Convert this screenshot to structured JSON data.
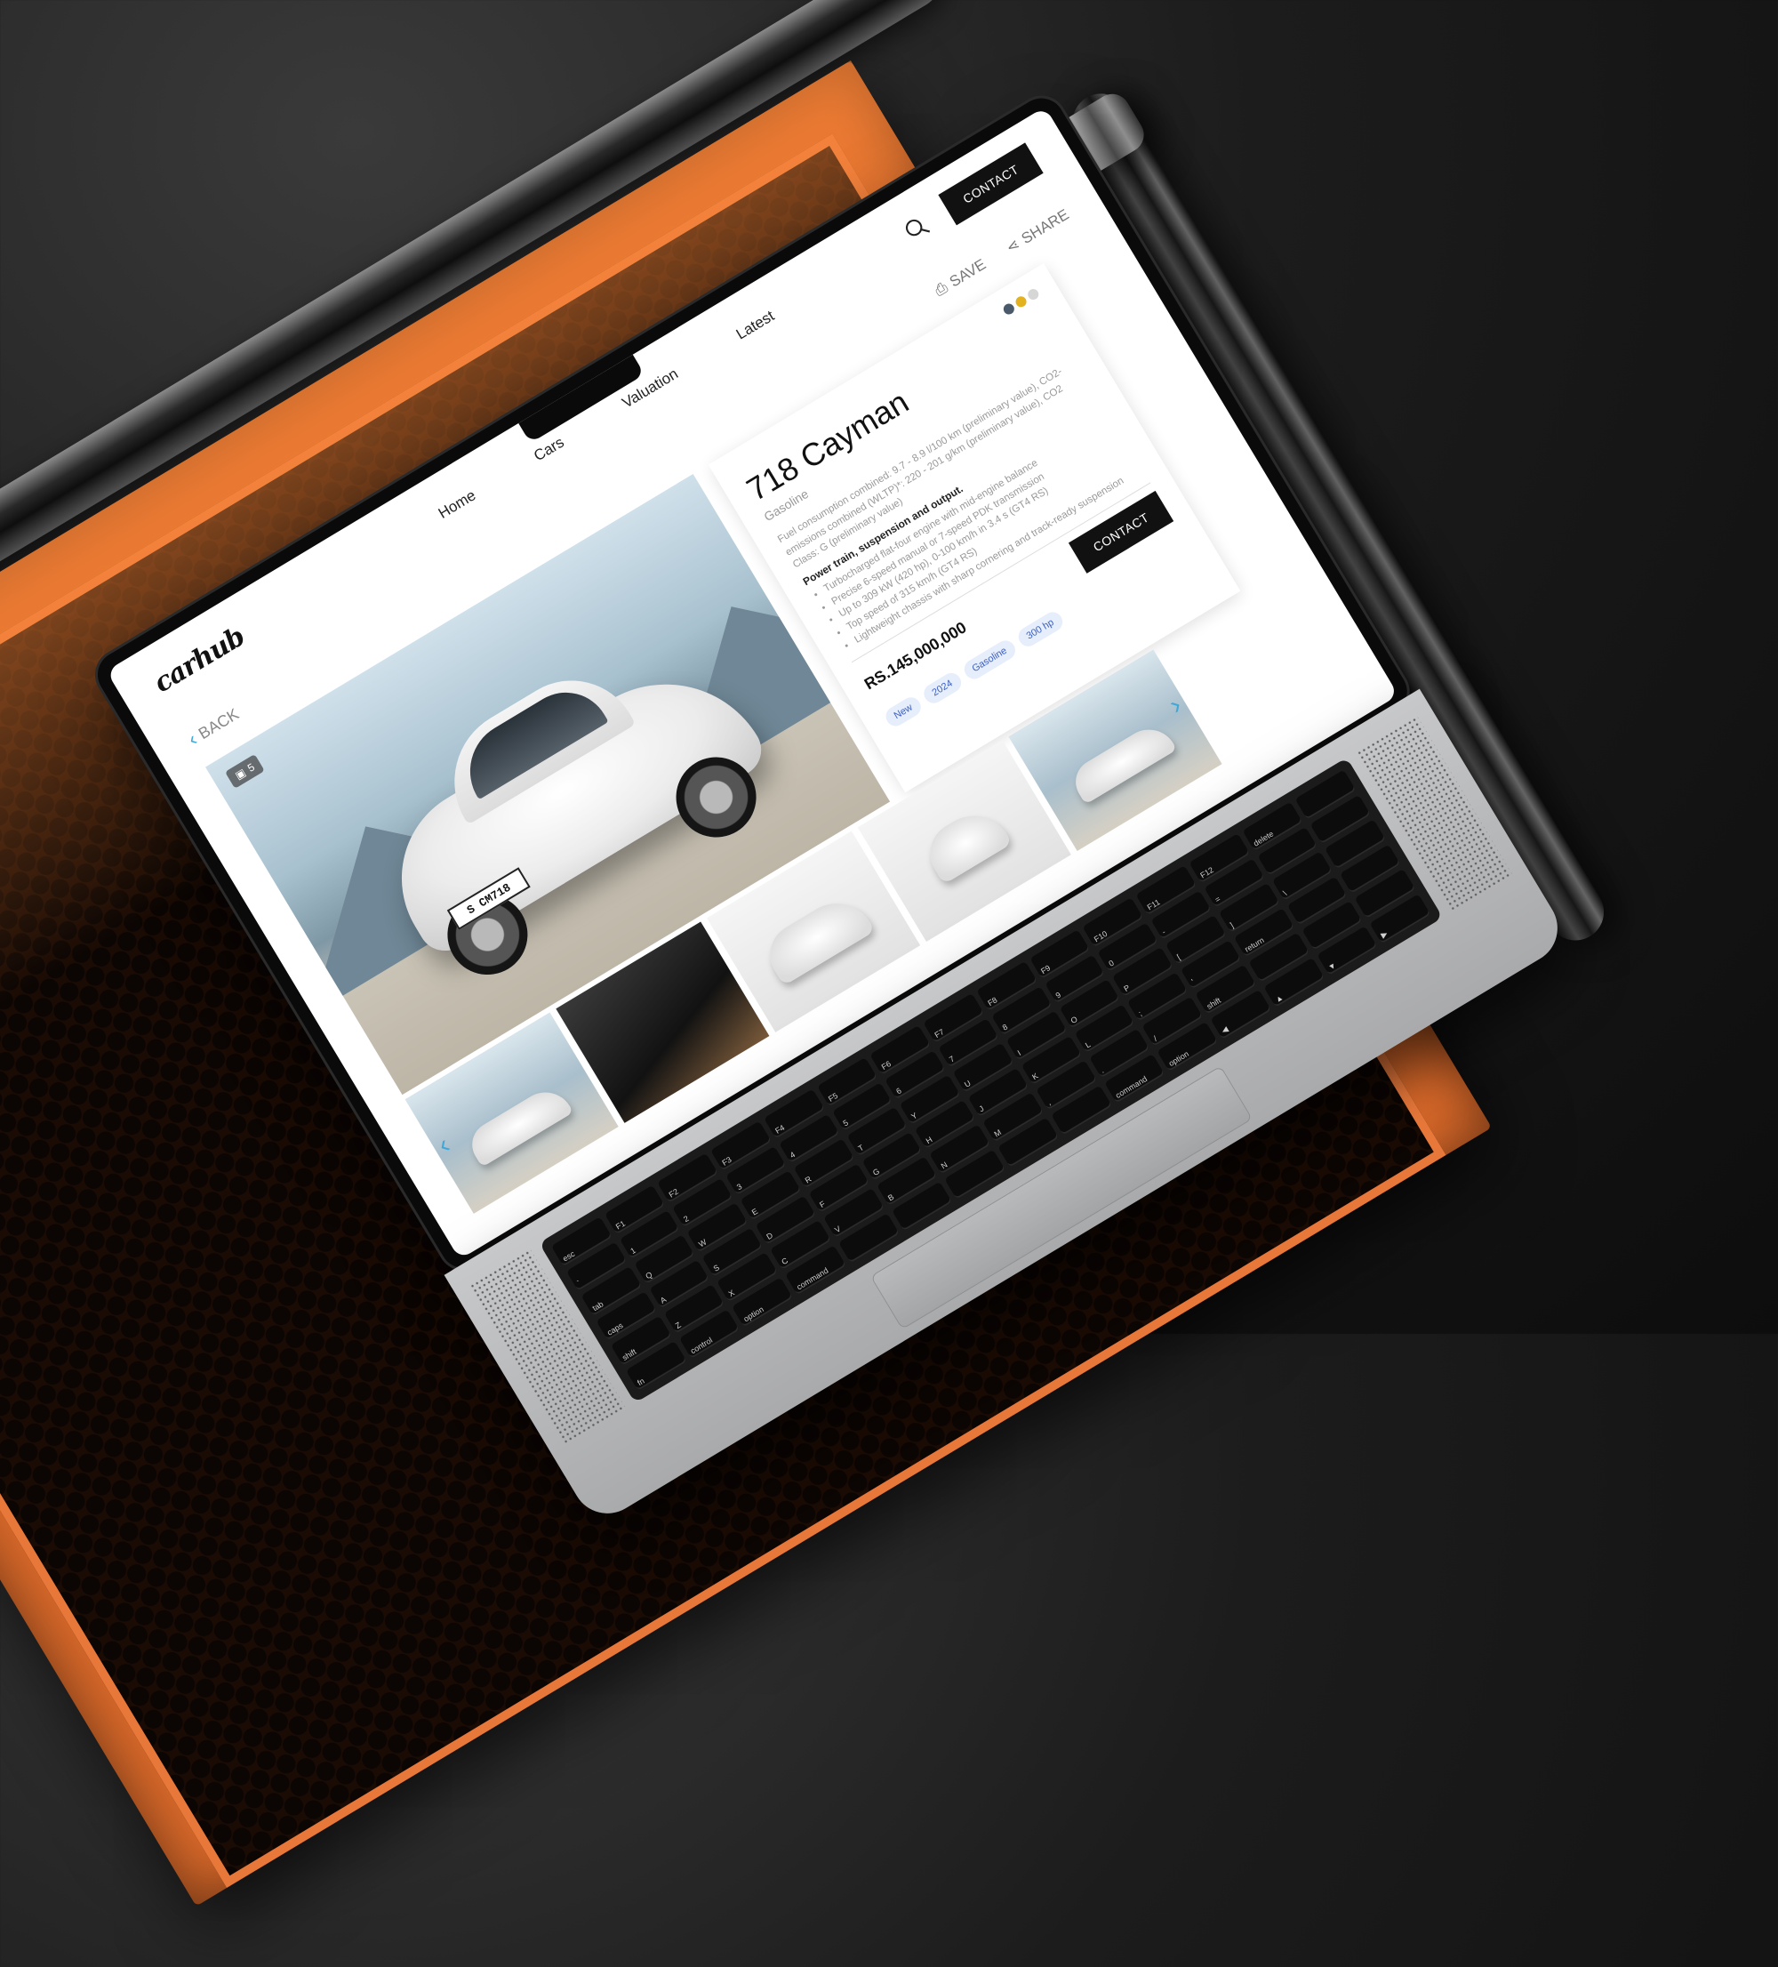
{
  "site": {
    "logo": "carhub",
    "nav": [
      "Home",
      "Cars",
      "Valuation",
      "Latest"
    ],
    "contact_label": "CONTACT"
  },
  "subbar": {
    "back_label": "BACK",
    "save_label": "SAVE",
    "share_label": "SHARE"
  },
  "hero": {
    "photo_count": "5",
    "plate": "S CM718"
  },
  "listing": {
    "title": "718 Cayman",
    "fuel": "Gasoline",
    "description": "Fuel consumption combined: 9.7 - 8.9 l/100 km (preliminary value), CO2-emissions combined (WLTP)*: 220 - 201 g/km (preliminary value), CO2 Class: G (preliminary value)",
    "spec_title": "Power train, suspension and output.",
    "specs": [
      "Turbocharged flat-four engine with mid-engine balance",
      "Precise 6-speed manual or 7-speed PDK transmission",
      "Up to 309 kW (420 hp), 0-100 km/h in 3.4 s (GT4 RS)",
      "Top speed of 315 km/h (GT4 RS)",
      "Lightweight chassis with sharp cornering and track-ready suspension"
    ],
    "price": "RS.145,000,000",
    "contact_label": "CONTACT",
    "tags": [
      "New",
      "2024",
      "Gasoline",
      "300 hp"
    ],
    "swatch_colors": [
      "#4a5a6a",
      "#e2b21f",
      "#d6d6d6"
    ]
  },
  "colors": {
    "accent": "#3fa8d8",
    "rack_orange": "#d9692a",
    "button_dark": "#111111"
  },
  "keyboard": {
    "keys": [
      "esc",
      "F1",
      "F2",
      "F3",
      "F4",
      "F5",
      "F6",
      "F7",
      "F8",
      "F9",
      "F10",
      "F11",
      "F12",
      "delete",
      "",
      "`",
      "1",
      "2",
      "3",
      "4",
      "5",
      "6",
      "7",
      "8",
      "9",
      "0",
      "-",
      "=",
      "",
      "",
      "tab",
      "Q",
      "W",
      "E",
      "R",
      "T",
      "Y",
      "U",
      "I",
      "O",
      "P",
      "[",
      "]",
      "\\",
      "",
      "caps",
      "A",
      "S",
      "D",
      "F",
      "G",
      "H",
      "J",
      "K",
      "L",
      ";",
      "'",
      "return",
      "",
      "",
      "shift",
      "Z",
      "X",
      "C",
      "V",
      "B",
      "N",
      "M",
      ",",
      ".",
      "/",
      "shift",
      "",
      "",
      "",
      "fn",
      "control",
      "option",
      "command",
      "",
      "",
      "",
      "",
      "",
      "command",
      "option",
      "◀",
      "▲",
      "▼",
      "▶"
    ]
  }
}
